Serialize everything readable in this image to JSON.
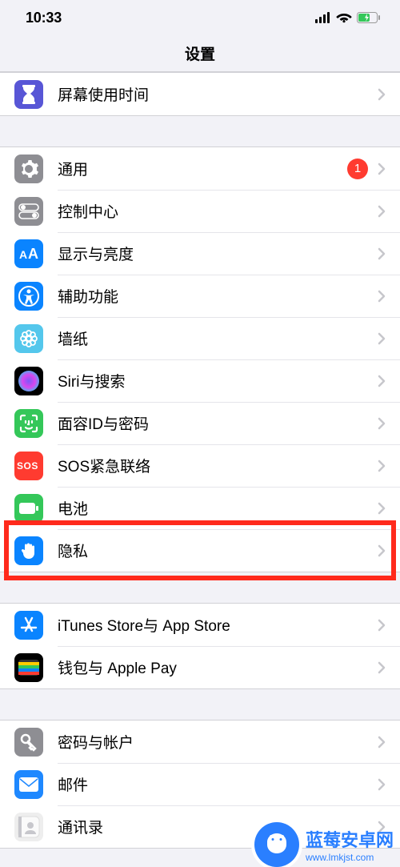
{
  "status": {
    "time": "10:33"
  },
  "header": {
    "title": "设置"
  },
  "groups": [
    {
      "rows": [
        {
          "id": "screen-time",
          "label": "屏幕使用时间",
          "icon": "hourglass",
          "bg": "#5856d6"
        }
      ]
    },
    {
      "rows": [
        {
          "id": "general",
          "label": "通用",
          "icon": "gear",
          "bg": "#8e8e93",
          "badge": "1"
        },
        {
          "id": "control-center",
          "label": "控制中心",
          "icon": "switches",
          "bg": "#8e8e93"
        },
        {
          "id": "display",
          "label": "显示与亮度",
          "icon": "aa",
          "bg": "#0a84ff"
        },
        {
          "id": "accessibility",
          "label": "辅助功能",
          "icon": "accessibility",
          "bg": "#0a84ff"
        },
        {
          "id": "wallpaper",
          "label": "墙纸",
          "icon": "flower",
          "bg": "#54c7ec"
        },
        {
          "id": "siri",
          "label": "Siri与搜索",
          "icon": "siri",
          "bg": "#000000"
        },
        {
          "id": "faceid",
          "label": "面容ID与密码",
          "icon": "faceid",
          "bg": "#34c759"
        },
        {
          "id": "sos",
          "label": "SOS紧急联络",
          "icon": "sos",
          "bg": "#ff3b30"
        },
        {
          "id": "battery",
          "label": "电池",
          "icon": "battery",
          "bg": "#34c759"
        },
        {
          "id": "privacy",
          "label": "隐私",
          "icon": "hand",
          "bg": "#0a84ff",
          "highlight": true
        }
      ]
    },
    {
      "rows": [
        {
          "id": "itunes",
          "label": "iTunes Store与 App Store",
          "icon": "appstore",
          "bg": "#0a84ff"
        },
        {
          "id": "wallet",
          "label": "钱包与 Apple Pay",
          "icon": "wallet",
          "bg": "#000000"
        }
      ]
    },
    {
      "rows": [
        {
          "id": "passwords",
          "label": "密码与帐户",
          "icon": "key",
          "bg": "#8e8e93"
        },
        {
          "id": "mail",
          "label": "邮件",
          "icon": "mail",
          "bg": "#1e88ff"
        },
        {
          "id": "contacts",
          "label": "通讯录",
          "icon": "contacts",
          "bg": "#eeeeee"
        }
      ]
    }
  ],
  "watermark": {
    "name": "蓝莓安卓网",
    "url": "www.lmkjst.com"
  }
}
